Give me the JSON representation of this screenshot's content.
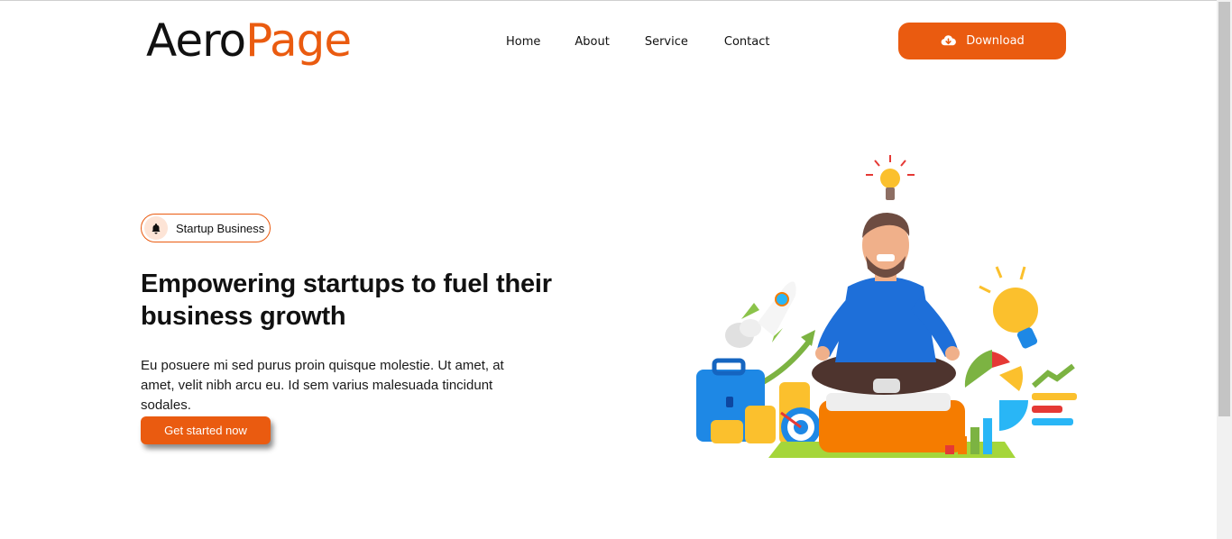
{
  "logo": {
    "part1": "Aero",
    "part2": "Page"
  },
  "nav": {
    "items": [
      "Home",
      "About",
      "Service",
      "Contact"
    ]
  },
  "download": {
    "label": "Download",
    "icon": "cloud-download-icon"
  },
  "hero": {
    "badge": {
      "label": "Startup Business",
      "icon": "bell-icon"
    },
    "headline": "Empowering startups to fuel their business growth",
    "description": "Eu posuere mi sed purus proin quisque molestie. Ut amet, at amet, velit nibh arcu eu. Id sem varius malesuada tincidunt sodales.",
    "cta_label": "Get started now",
    "illustration": "meditating-businessman-illustration"
  },
  "colors": {
    "accent": "#ea5b10",
    "text": "#111111",
    "background": "#ffffff"
  }
}
